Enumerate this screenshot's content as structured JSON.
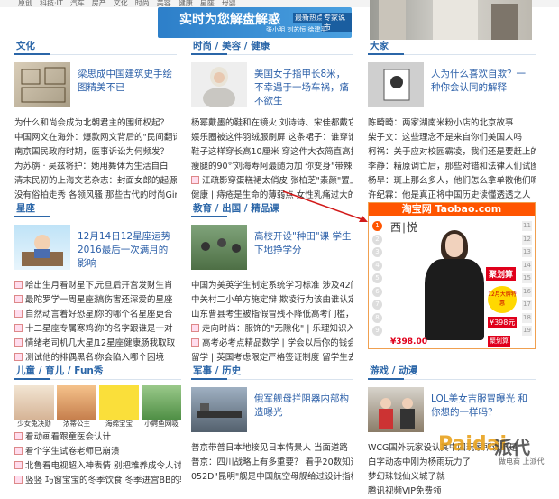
{
  "topbar": {
    "strip": [
      "原创",
      "科技·IT",
      "汽车",
      "房产",
      "文化",
      "时尚",
      "美容",
      "健康",
      "星座",
      "母婴"
    ]
  },
  "promo": {
    "title": "实时为您解盘解惑",
    "tag1": "最新热点",
    "tag2": "专家说市",
    "people": "张小明  刘苏恒  徐建平"
  },
  "sections": {
    "wenhua": {
      "name": "文化",
      "feat": "梁思成中国建筑史手绘图精美不已",
      "items": [
        "为什么和尚会成为北朝君主的围师权起？",
        "中国网文在海外：爆款网文背后的\"民间翻译组\"",
        "南京国民政府时期，医事诉讼为何频发？",
        "为苏旃 · 吴兹将护：她用舞体为生活自白",
        "清末民初的上海文艺杂志：封面女郎的起源",
        "没有俗拍走秀 各领风骚 那些古代的时尚Girl们"
      ]
    },
    "shishang": {
      "name": "时尚 / 美容 / 健康",
      "feat": "美国女子指甲长8米，不幸遇于一场车祸，痛不欲生",
      "items": [
        "杨幂戴墨的鞋和在镜火 刘诗诗、宋佳都戴它还吃",
        "娱乐圈被这件羽绒服刷屏 这条裙子：谁穿谁先瘦",
        "鞋子这样穿长高10厘米 穿这件大衣简直高挑5岁",
        "瘦腿的90°′刘海寿阿最随为加 你变身\"带辣\"太美了",
        "江疏影穿蛋糕裙太俏皮 张柏芝\"素颜\"置上封面",
        "健康 | 痔疮是生命的薄弱点 女性乳痛过大的危害"
      ]
    },
    "dajia": {
      "name": "大家",
      "feat": "人为什么喜欢自欺？一种你会认同的解释",
      "items": [
        "陈畸畸：两家湖南米粉小店的北京故事",
        "柴子文：这些理念不是来自你们美国人吗",
        "柯祸：关于应对校园霸凌，我们还是要赶上的一课",
        "李静：精原调亡后，那些对错和法律人们试图得好吗",
        "杨早：斑上那么多人，他们怎么拿单散他们呢？",
        "许纪霖：他是真正将中国历史读懂透透之人"
      ]
    },
    "xingzuo": {
      "name": "星座",
      "feat": "12月14日12星座运势 2016最后一次满月的影响",
      "col1": [
        "哈出生月看财星下凡",
        "最陀罗学一周星座运",
        "自然动言着好恐星座",
        "十二星座专属寒鸡汤",
        "情绪老司机几大星座",
        "测试他的排偶黑名单"
      ],
      "col2": [
        "元旦后开宫发财生肖",
        "搞伤害还深爱的星座",
        "你的哪个名星座更合",
        "你的名字跟谁是一对",
        "12星座健康肠我取取",
        "你会陷入哪个困境"
      ]
    },
    "jiaoyu": {
      "name": "教育 / 出国 / 精品课",
      "feat": "高校开设\"种田\"课 学生下地挣学分",
      "items": [
        "中国为美英学生制定系统学习标准 涉及42门学科",
        "中关村二小单方施定辩 欺凌行为该由谁认定",
        "山东曹县考生被指假冒残不降低高考门槛，获刑半年",
        "走向时尚：服饰的\"无隙化\" | 乐理知识入门",
        "高考必考点精品数学 | 学会以后你的钱会高",
        "留学 | 英国考虑限定严格签证制度 留学生去找成本"
      ]
    },
    "ertong": {
      "name": "儿童 / 育儿 / Fun秀",
      "caps": [
        "少女兔决勋",
        "浓蒂公主",
        "海绵宝宝",
        "小鳄鱼网吸"
      ],
      "items": [
        "看动画看跟童医会认计",
        "看个学生试卷老师已崩溃",
        "北鲁看电视超入神表情 别把难养成令人讨厌的人",
        "竖竖 巧窗宝宝的冬季饮食 冬季进宫BB的辅食"
      ]
    },
    "junshi": {
      "name": "军事 / 历史",
      "feat": "俄军舰母拦阻器内部构造曝光",
      "items": [
        "普京带普日本地接见日本情景人 当面道路",
        "普京：四川战略上有多重要？ 看乎20数知道了",
        "052D\"昆明\"舰是中国航空母舰给过设计指标"
      ]
    },
    "youxi": {
      "name": "游戏 / 动漫",
      "feat": "LOL美女吉服冒曝光 和你想的一样吗？",
      "items": [
        "WCG国外玩家设认其中国玩家所说不是",
        "白字动态中刚为杨雨玩力了",
        "梦幻珠钱仙义城了就",
        "腾讯视频VIP免费领"
      ]
    }
  },
  "taobao": {
    "head": "淘宝网 Taobao.com",
    "brand": "西∣悦",
    "price": "¥398.00",
    "tag": "聚划算",
    "tag2": "12月大牌特惠",
    "tag3": "¥398元",
    "buy": "聚划算"
  },
  "watermark": {
    "a": "Paidai",
    "b": "派代",
    "c": "做电商 上派代"
  }
}
